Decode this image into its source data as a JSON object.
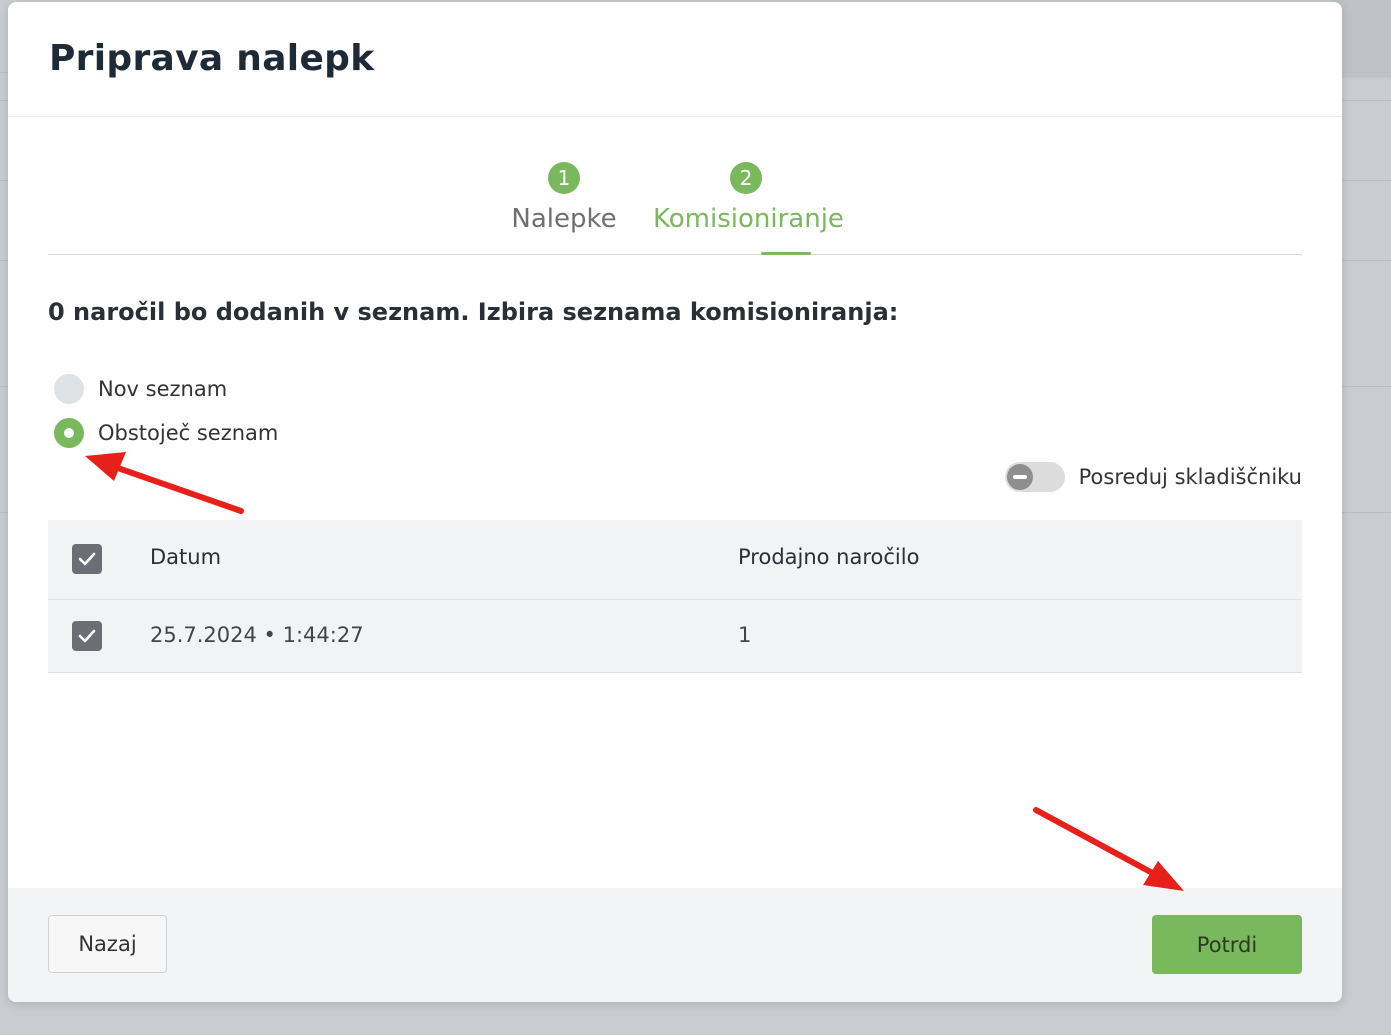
{
  "modal": {
    "title": "Priprava nalepk"
  },
  "stepper": {
    "steps": [
      {
        "number": "1",
        "label": "Nalepke",
        "active": false
      },
      {
        "number": "2",
        "label": "Komisioniranje",
        "active": true
      }
    ]
  },
  "prompt": "0 naročil bo dodanih v seznam. Izbira seznama komisioniranja:",
  "options": [
    {
      "label": "Nov seznam",
      "selected": false
    },
    {
      "label": "Obstoječ seznam",
      "selected": true
    }
  ],
  "toggle": {
    "label": "Posreduj skladiščniku",
    "on": false
  },
  "table": {
    "headers": {
      "date": "Datum",
      "order": "Prodajno naročilo"
    },
    "rows": [
      {
        "date": "25.7.2024 • 1:44:27",
        "order": "1",
        "checked": true
      }
    ]
  },
  "footer": {
    "back_label": "Nazaj",
    "confirm_label": "Potrdi"
  },
  "colors": {
    "accent": "#79b85d",
    "annotation_arrow": "#e8201a"
  }
}
